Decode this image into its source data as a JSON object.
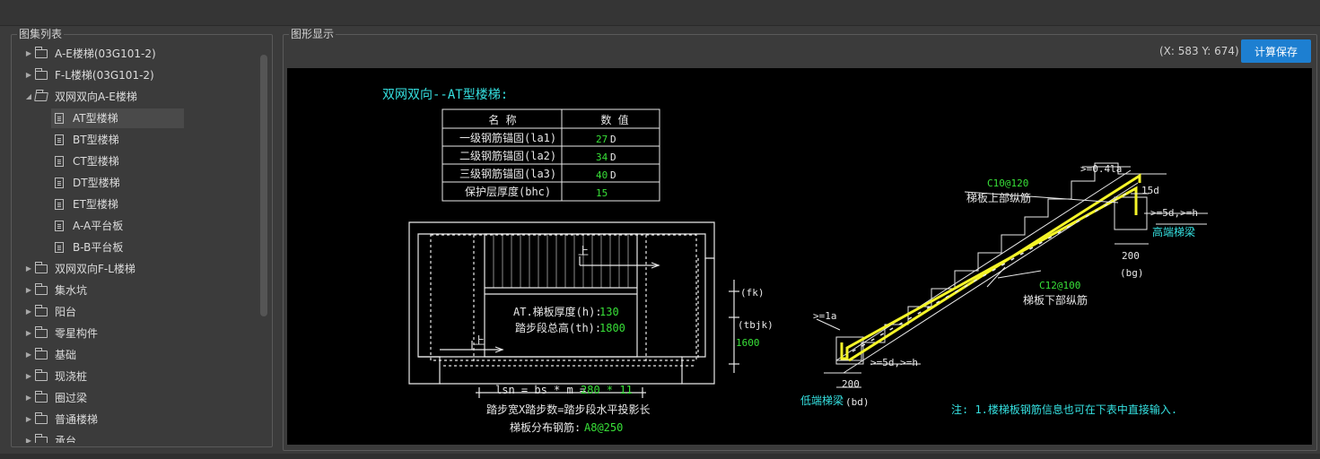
{
  "panels": {
    "left_title": "图集列表",
    "right_title": "图形显示"
  },
  "tree": {
    "items": [
      {
        "label": "A-E楼梯(03G101-2)"
      },
      {
        "label": "F-L楼梯(03G101-2)"
      },
      {
        "label": "双网双向A-E楼梯"
      },
      {
        "label": "AT型楼梯"
      },
      {
        "label": "BT型楼梯"
      },
      {
        "label": "CT型楼梯"
      },
      {
        "label": "DT型楼梯"
      },
      {
        "label": "ET型楼梯"
      },
      {
        "label": "A-A平台板"
      },
      {
        "label": "B-B平台板"
      },
      {
        "label": "双网双向F-L楼梯"
      },
      {
        "label": "集水坑"
      },
      {
        "label": "阳台"
      },
      {
        "label": "零星构件"
      },
      {
        "label": "基础"
      },
      {
        "label": "现浇桩"
      },
      {
        "label": "圈过梁"
      },
      {
        "label": "普通楼梯"
      },
      {
        "label": "承台"
      }
    ]
  },
  "toolbar": {
    "coords": "(X: 583 Y: 674)",
    "save_label": "计算保存"
  },
  "drawing": {
    "title": "双网双向--AT型楼梯:",
    "table": {
      "headers": [
        "名  称",
        "数  值"
      ],
      "rows": [
        {
          "name": "一级钢筋锚固(la1)",
          "value": "27",
          "unit": "D"
        },
        {
          "name": "二级钢筋锚固(la2)",
          "value": "34",
          "unit": "D"
        },
        {
          "name": "三级钢筋锚固(la3)",
          "value": "40",
          "unit": "D"
        },
        {
          "name": "保护层厚度(bhc)",
          "value": "15",
          "unit": ""
        }
      ]
    },
    "plan": {
      "up1": "上",
      "up2": "上",
      "thickness_label": "AT.梯板厚度(h):",
      "thickness_value": "130",
      "height_label": "踏步段总高(th):",
      "height_value": "1800",
      "fk": "(fk)",
      "tbjk": "(tbjk)",
      "tbjk_value": "1600",
      "lsn_label": "lsn = bs * m =",
      "lsn_value": "280 * 11",
      "step_desc": "踏步宽X踏步数=踏步段水平投影长",
      "dist_label": "梯板分布钢筋:",
      "dist_value": "A8@250"
    },
    "section": {
      "top_bar": "C10@120",
      "top_bar_desc": "梯板上部纵筋",
      "bottom_bar": "C12@100",
      "bottom_bar_desc": "梯板下部纵筋",
      "top_anchor": ">=0.4la",
      "top_hook": "15d",
      "top_embed": ">=5d,>=h",
      "high_beam": "高端梯梁",
      "high_beam_width": "200",
      "bg": "(bg)",
      "low_anchor": ">=1a",
      "low_embed": ">=5d,>=h",
      "low_beam_width": "200",
      "low_beam": "低端梯梁",
      "bd": "(bd)",
      "note": "注: 1.楼梯板钢筋信息也可在下表中直接输入."
    },
    "colors": {
      "cyan": "#35e0e0",
      "green": "#38e038",
      "yellow": "#f4f428",
      "white": "#e8e8e8"
    }
  }
}
